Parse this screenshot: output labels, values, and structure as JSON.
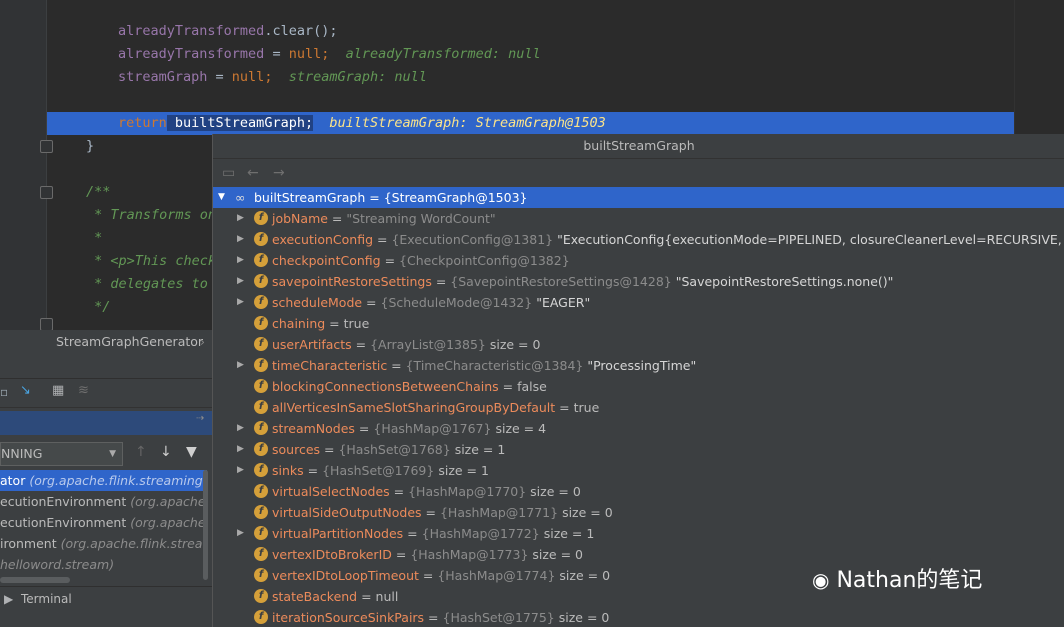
{
  "editor": {
    "lines": [
      {
        "code_a": "alreadyTransformed",
        "code_b": ".clear();"
      },
      {
        "code_a": "alreadyTransformed",
        "code_b": " = ",
        "kw": "null",
        "semi": ";",
        "hint": "alreadyTransformed: null"
      },
      {
        "code_a": "streamGraph",
        "code_b": " = ",
        "kw": "null",
        "semi": ";",
        "hint": "streamGraph: null"
      },
      {
        "kw_return": "return",
        "code": " builtStreamGraph;",
        "hint": "builtStreamGraph: StreamGraph@1503"
      },
      {
        "code": "}"
      },
      {
        "comment": "/**"
      },
      {
        "comment": " * Transforms on"
      },
      {
        "comment": " *"
      },
      {
        "comment": " * <p>This check"
      },
      {
        "comment": " * delegates to"
      },
      {
        "comment": " */"
      }
    ]
  },
  "breadcrumb": "StreamGraphGenerator",
  "debug": {
    "thread": "NNING",
    "frames": [
      {
        "method": "ator",
        "cls": "(org.apache.flink.streaming.api",
        "selected": true
      },
      {
        "method": "ecutionEnvironment",
        "cls": "(org.apache.flink"
      },
      {
        "method": "ecutionEnvironment",
        "cls": "(org.apache.flink"
      },
      {
        "method": "ironment",
        "cls": "(org.apache.flink.streamin"
      },
      {
        "method": "",
        "cls": "helloword.stream)"
      }
    ],
    "terminal": "Terminal"
  },
  "popup": {
    "title": "builtStreamGraph",
    "root": "builtStreamGraph = {StreamGraph@1503}",
    "fields": [
      {
        "name": "jobName",
        "ref": "",
        "val": "\"Streaming WordCount\"",
        "expand": true
      },
      {
        "name": "executionConfig",
        "ref": "{ExecutionConfig@1381}",
        "val": "\"ExecutionConfig{executionMode=PIPELINED, closureCleanerLevel=RECURSIVE, parallelism=",
        "expand": true
      },
      {
        "name": "checkpointConfig",
        "ref": "{CheckpointConfig@1382}",
        "val": "",
        "expand": true
      },
      {
        "name": "savepointRestoreSettings",
        "ref": "{SavepointRestoreSettings@1428}",
        "val": "\"SavepointRestoreSettings.none()\"",
        "expand": true
      },
      {
        "name": "scheduleMode",
        "ref": "{ScheduleMode@1432}",
        "val": "\"EAGER\"",
        "expand": true
      },
      {
        "name": "chaining",
        "ref": "",
        "val": "true",
        "expand": false
      },
      {
        "name": "userArtifacts",
        "ref": "{ArrayList@1385}",
        "val": "size = 0",
        "expand": false
      },
      {
        "name": "timeCharacteristic",
        "ref": "{TimeCharacteristic@1384}",
        "val": "\"ProcessingTime\"",
        "expand": true
      },
      {
        "name": "blockingConnectionsBetweenChains",
        "ref": "",
        "val": "false",
        "expand": false
      },
      {
        "name": "allVerticesInSameSlotSharingGroupByDefault",
        "ref": "",
        "val": "true",
        "expand": false
      },
      {
        "name": "streamNodes",
        "ref": "{HashMap@1767}",
        "val": "size = 4",
        "expand": true
      },
      {
        "name": "sources",
        "ref": "{HashSet@1768}",
        "val": "size = 1",
        "expand": true
      },
      {
        "name": "sinks",
        "ref": "{HashSet@1769}",
        "val": "size = 1",
        "expand": true
      },
      {
        "name": "virtualSelectNodes",
        "ref": "{HashMap@1770}",
        "val": "size = 0",
        "expand": false
      },
      {
        "name": "virtualSideOutputNodes",
        "ref": "{HashMap@1771}",
        "val": "size = 0",
        "expand": false
      },
      {
        "name": "virtualPartitionNodes",
        "ref": "{HashMap@1772}",
        "val": "size = 1",
        "expand": true
      },
      {
        "name": "vertexIDtoBrokerID",
        "ref": "{HashMap@1773}",
        "val": "size = 0",
        "expand": false
      },
      {
        "name": "vertexIDtoLoopTimeout",
        "ref": "{HashMap@1774}",
        "val": "size = 0",
        "expand": false
      },
      {
        "name": "stateBackend",
        "ref": "",
        "val": "null",
        "expand": false
      },
      {
        "name": "iterationSourceSinkPairs",
        "ref": "{HashSet@1775}",
        "val": "size = 0",
        "expand": false
      }
    ]
  },
  "watermark": "Nathan的笔记"
}
